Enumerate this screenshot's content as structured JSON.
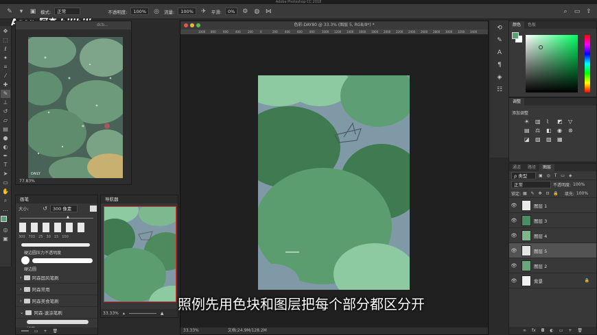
{
  "app_title": "Adobe Photoshop CC 2018",
  "options_bar": {
    "mode_label": "模式:",
    "mode_value": "正常",
    "opacity_label": "不透明度:",
    "opacity_value": "100%",
    "flow_label": "流量:",
    "flow_value": "100%",
    "smooth_label": "平滑:",
    "smooth_value": "0%"
  },
  "watermark": {
    "author": "Asen-阿森",
    "site": "bilibili"
  },
  "reference_window": {
    "title": "dcb...",
    "zoom": "77.83%",
    "caption": "DAILY"
  },
  "brush_panel": {
    "tab": "画笔",
    "size_label": "大小:",
    "size_value": "300 像素",
    "preset_numbers": [
      "300",
      "703",
      "25",
      "30",
      "15",
      "100"
    ],
    "stroke1_label": "硬边圆压力不透明度",
    "stroke2_label": "硬边圆",
    "folders": [
      "阿森国风笔刷",
      "阿森常用",
      "阿森美食笔刷",
      "阿森-速涂笔刷"
    ],
    "sub_item": "好用"
  },
  "navigator": {
    "tab": "导航器",
    "zoom": "33.33%"
  },
  "document": {
    "title": "色彩-DAY80 @ 33.3% (图层 5, RGB/8*) *",
    "status_zoom": "33.33%",
    "status_doc": "文档:24.9M/128.2M",
    "ruler_ticks": [
      "1000",
      "800",
      "600",
      "400",
      "200",
      "0",
      "200",
      "400",
      "600",
      "800",
      "1000",
      "1200",
      "1400",
      "1600",
      "1800",
      "2000",
      "2200",
      "2400",
      "2600",
      "2800",
      "3000",
      "3200",
      "3400"
    ]
  },
  "color_panel": {
    "tabs": [
      "颜色",
      "色板"
    ]
  },
  "adjust_panel": {
    "tab": "调整",
    "add_label": "添加调整"
  },
  "layers_panel": {
    "tabs": [
      "通道",
      "路径",
      "图层"
    ],
    "filter_label": "ρ 类型",
    "blend_mode": "正常",
    "opacity_label": "不透明度:",
    "opacity_value": "100%",
    "lock_label": "锁定:",
    "fill_label": "填充:",
    "fill_value": "100%",
    "layers": [
      {
        "name": "图层 1",
        "selected": false,
        "thumb": "#e9e9e9"
      },
      {
        "name": "图层 3",
        "selected": false,
        "thumb": "#4d8d64"
      },
      {
        "name": "图层 4",
        "selected": false,
        "thumb": "#7fb48c"
      },
      {
        "name": "图层 5",
        "selected": true,
        "thumb": "#e6e6e6"
      },
      {
        "name": "图层 2",
        "selected": false,
        "thumb": "#6aa57e"
      },
      {
        "name": "背景",
        "selected": false,
        "thumb": "#f2f2f2"
      }
    ]
  },
  "subtitle": "照例先用色块和图层把每个部分都区分开",
  "colors": {
    "foreground": "#5a9e78",
    "background": "#ffffff",
    "canvas_bg": "#8dcaa2",
    "leaf_dark": "#3f7a50",
    "leaf_mid": "#5c9d70",
    "water": "#7f9aa6"
  }
}
